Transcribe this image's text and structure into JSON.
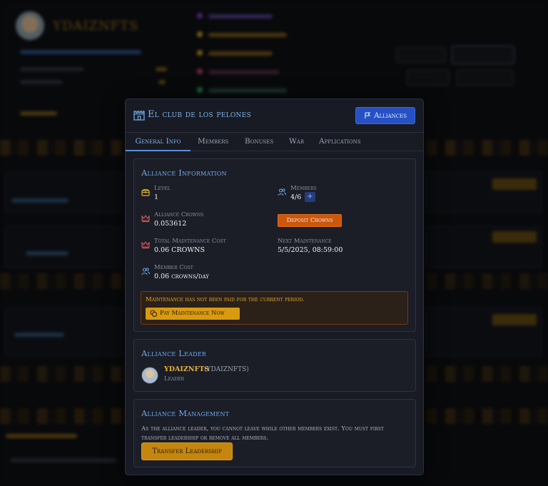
{
  "modal": {
    "title": "El club de los pelones",
    "alliances_button": "Alliances",
    "tabs": [
      {
        "label": "General Info",
        "active": true
      },
      {
        "label": "Members",
        "active": false
      },
      {
        "label": "Bonuses",
        "active": false
      },
      {
        "label": "War",
        "active": false
      },
      {
        "label": "Applications",
        "active": false
      }
    ]
  },
  "info": {
    "title": "Alliance Information",
    "level_label": "Level",
    "level_value": "1",
    "members_label": "Members",
    "members_value": "4/6",
    "members_add": "+",
    "crowns_label": "Alliance Crowns",
    "crowns_value": "0.053612",
    "deposit_button": "Deposit Crowns",
    "maint_cost_label": "Total Maintenance Cost",
    "maint_cost_value": "0.06 CROWNS",
    "next_maint_label": "Next Maintenance",
    "next_maint_value": "5/5/2025, 08:59:00",
    "member_cost_label": "Member Cost",
    "member_cost_value": "0.06 crowns/day",
    "warning_text": "Maintenance has not been paid for the current period.",
    "pay_button": "Pay Maintenance Now"
  },
  "leader": {
    "title": "Alliance Leader",
    "name": "YDAIZNFTS",
    "handle": "(YDAIZNFTS)",
    "role": "Leader"
  },
  "management": {
    "title": "Alliance Management",
    "text": "As the alliance leader, you cannot leave while other members exist. You must first transfer leadership or remove all members.",
    "transfer_button": "Transfer Leadership"
  },
  "colors": {
    "accent_blue": "#2650c4",
    "title_blue": "#6fa8e8",
    "warning_orange": "#c9580e",
    "gold": "#d89a10"
  }
}
